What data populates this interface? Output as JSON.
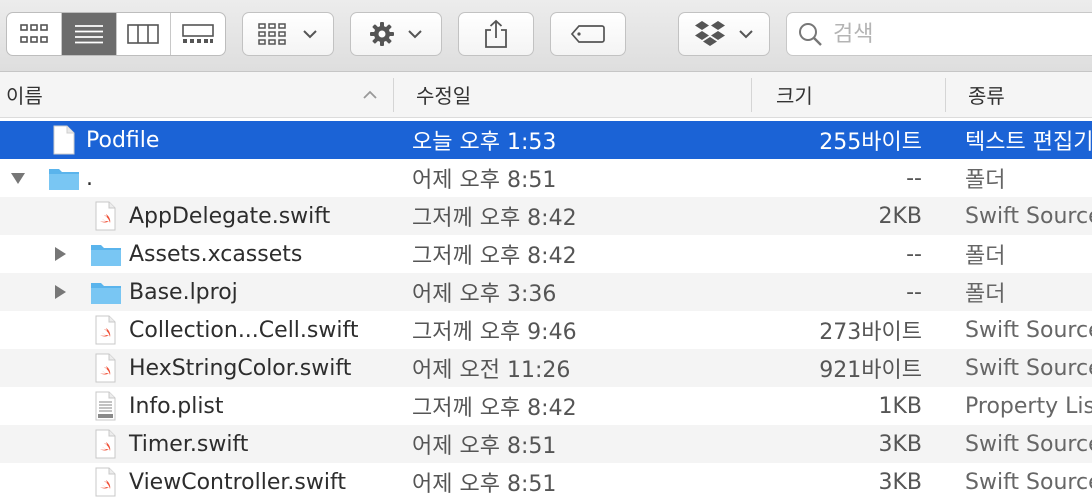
{
  "toolbar": {
    "view_modes": [
      "icon-view",
      "list-view",
      "column-view",
      "gallery-view"
    ],
    "active_view": "list-view",
    "search_placeholder": "검색"
  },
  "columns": {
    "name": "이름",
    "date": "수정일",
    "size": "크기",
    "kind": "종류"
  },
  "rows": [
    {
      "name": "Podfile",
      "date": "오늘 오후 1:53",
      "size": "255바이트",
      "kind": "텍스트 편집기",
      "icon": "document-icon",
      "level": 0,
      "disclosure": "none",
      "selected": true
    },
    {
      "name": ".",
      "date": "어제 오후 8:51",
      "size": "--",
      "kind": "폴더",
      "icon": "folder-icon",
      "level": 0,
      "disclosure": "expanded"
    },
    {
      "name": "AppDelegate.swift",
      "date": "그저께 오후 8:42",
      "size": "2KB",
      "kind": "Swift Source",
      "icon": "swift-file-icon",
      "level": 1,
      "disclosure": "none"
    },
    {
      "name": "Assets.xcassets",
      "date": "그저께 오후 8:42",
      "size": "--",
      "kind": "폴더",
      "icon": "folder-icon",
      "level": 1,
      "disclosure": "collapsed"
    },
    {
      "name": "Base.lproj",
      "date": "어제 오후 3:36",
      "size": "--",
      "kind": "폴더",
      "icon": "folder-icon",
      "level": 1,
      "disclosure": "collapsed"
    },
    {
      "name": "Collection...Cell.swift",
      "date": "그저께 오후 9:46",
      "size": "273바이트",
      "kind": "Swift Source",
      "icon": "swift-file-icon",
      "level": 1,
      "disclosure": "none"
    },
    {
      "name": "HexStringColor.swift",
      "date": "어제 오전 11:26",
      "size": "921바이트",
      "kind": "Swift Source",
      "icon": "swift-file-icon",
      "level": 1,
      "disclosure": "none"
    },
    {
      "name": "Info.plist",
      "date": "그저께 오후 8:42",
      "size": "1KB",
      "kind": "Property List",
      "icon": "plist-file-icon",
      "level": 1,
      "disclosure": "none"
    },
    {
      "name": "Timer.swift",
      "date": "어제 오후 8:51",
      "size": "3KB",
      "kind": "Swift Source",
      "icon": "swift-file-icon",
      "level": 1,
      "disclosure": "none"
    },
    {
      "name": "ViewController.swift",
      "date": "어제 오후 8:51",
      "size": "3KB",
      "kind": "Swift Source",
      "icon": "swift-file-icon",
      "level": 1,
      "disclosure": "none"
    }
  ],
  "colors": {
    "selection": "#1b63d6",
    "folder": "#5ab4ec",
    "swift": "#f05138"
  }
}
